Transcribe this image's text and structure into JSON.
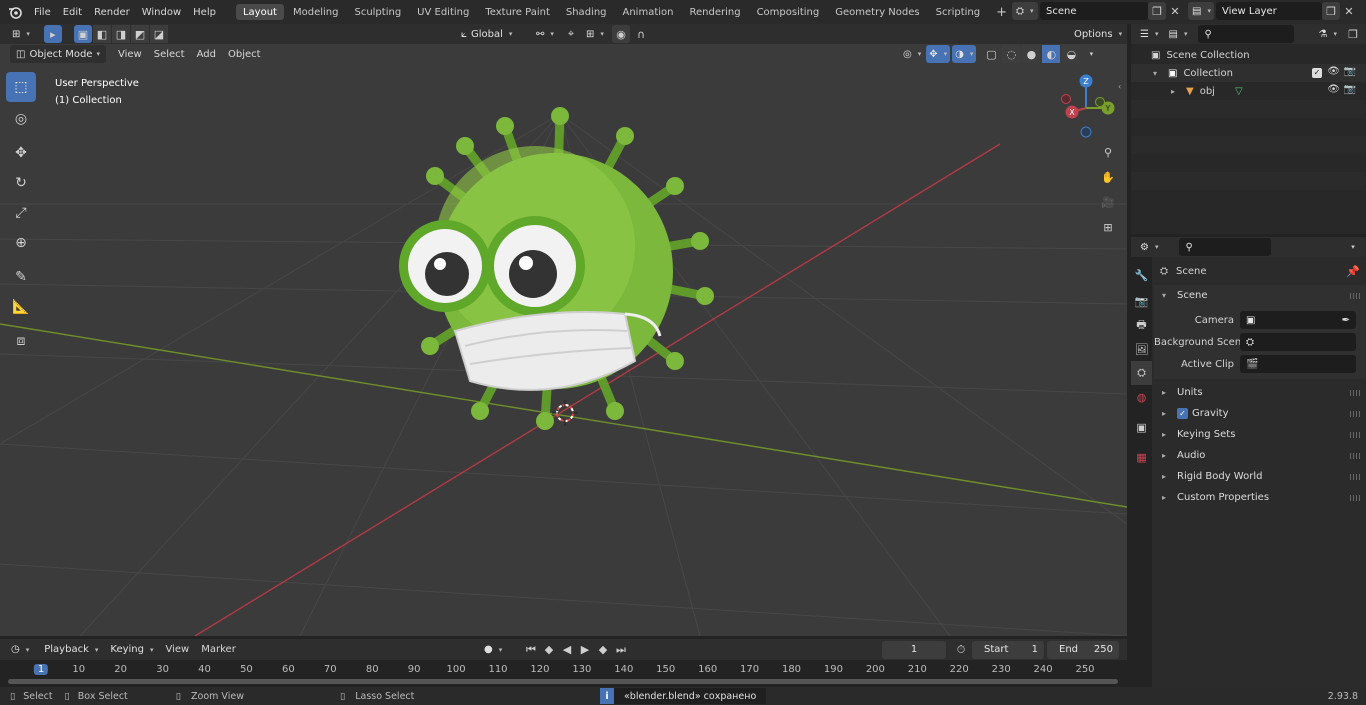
{
  "app_version": "2.93.8",
  "menu": [
    "File",
    "Edit",
    "Render",
    "Window",
    "Help"
  ],
  "workspaces": [
    "Layout",
    "Modeling",
    "Sculpting",
    "UV Editing",
    "Texture Paint",
    "Shading",
    "Animation",
    "Rendering",
    "Compositing",
    "Geometry Nodes",
    "Scripting"
  ],
  "active_workspace": "Layout",
  "scene_name": "Scene",
  "view_layer": "View Layer",
  "viewport": {
    "mode": "Object Mode",
    "menus": [
      "View",
      "Select",
      "Add",
      "Object"
    ],
    "transform_orientation": "Global",
    "options_label": "Options",
    "overlay_line1": "User Perspective",
    "overlay_line2": "(1) Collection",
    "gizmo_axes": {
      "z": "Z",
      "y": "Y",
      "x": "X"
    }
  },
  "outliner": {
    "root": "Scene Collection",
    "collection": "Collection",
    "object": "obj"
  },
  "properties": {
    "header": "Scene",
    "panel": "Scene",
    "fields": [
      {
        "label": "Camera",
        "value": ""
      },
      {
        "label": "Background Scene",
        "value": ""
      },
      {
        "label": "Active Clip",
        "value": ""
      }
    ],
    "sections": [
      "Units",
      "Gravity",
      "Keying Sets",
      "Audio",
      "Rigid Body World",
      "Custom Properties"
    ]
  },
  "timeline": {
    "menus": [
      "Playback",
      "Keying",
      "View",
      "Marker"
    ],
    "current_frame": "1",
    "start_label": "Start",
    "start": "1",
    "end_label": "End",
    "end": "250",
    "ticks": [
      "1",
      "10",
      "20",
      "30",
      "40",
      "50",
      "60",
      "70",
      "80",
      "90",
      "100",
      "110",
      "120",
      "130",
      "140",
      "150",
      "160",
      "170",
      "180",
      "190",
      "200",
      "210",
      "220",
      "230",
      "240",
      "250"
    ]
  },
  "status": {
    "select": "Select",
    "box_select": "Box Select",
    "zoom_view": "Zoom View",
    "lasso_select": "Lasso Select",
    "message": "«blender.blend» сохранено"
  },
  "colors": {
    "accent": "#4772b3",
    "x_axis": "#c1414d",
    "y_axis": "#7aa02c",
    "z_axis": "#3b7fd1",
    "virus": "#7cb83c"
  }
}
